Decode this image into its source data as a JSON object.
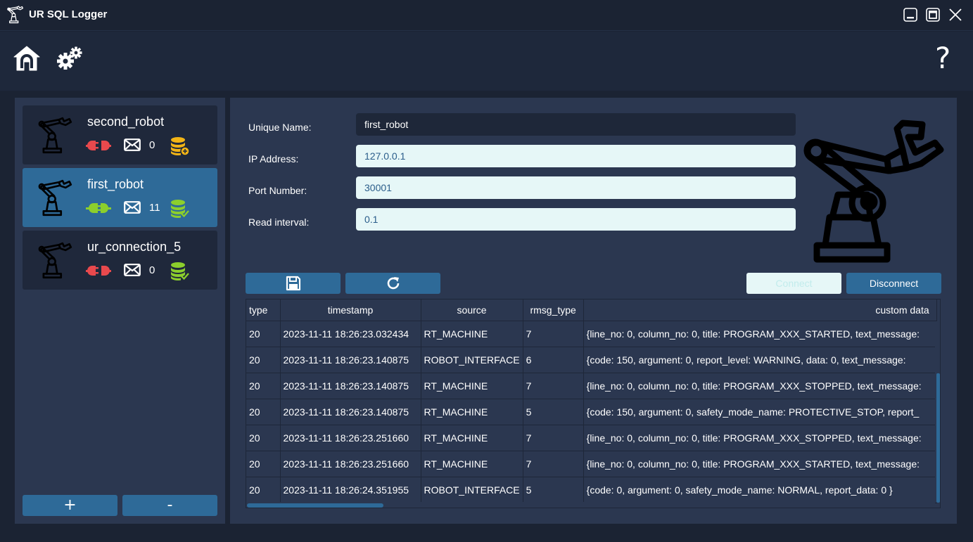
{
  "app": {
    "title": "UR SQL Logger"
  },
  "toolbar": {
    "help_label": "?"
  },
  "connections": [
    {
      "name": "second_robot",
      "status": "disconnected",
      "message_count": "0",
      "db_state": "pending"
    },
    {
      "name": "first_robot",
      "status": "connected",
      "message_count": "11",
      "db_state": "ok"
    },
    {
      "name": "ur_connection_5",
      "status": "disconnected",
      "message_count": "0",
      "db_state": "ok"
    }
  ],
  "sidebar": {
    "add_label": "+",
    "remove_label": "-"
  },
  "form": {
    "unique_name": {
      "label": "Unique Name:",
      "value": "first_robot"
    },
    "ip_address": {
      "label": "IP Address:",
      "value": "127.0.0.1"
    },
    "port_number": {
      "label": "Port Number:",
      "value": "30001"
    },
    "read_interval": {
      "label": "Read interval:",
      "value": "0.1"
    }
  },
  "buttons": {
    "connect_label": "Connect",
    "disconnect_label": "Disconnect"
  },
  "table": {
    "columns": [
      "type",
      "timestamp",
      "source",
      "rmsg_type",
      "custom data"
    ],
    "rows": [
      [
        "20",
        "2023-11-11 18:26:23.032434",
        "RT_MACHINE",
        "7",
        "{line_no: 0, column_no: 0, title: PROGRAM_XXX_STARTED, text_message: "
      ],
      [
        "20",
        "2023-11-11 18:26:23.140875",
        "ROBOT_INTERFACE",
        "6",
        "{code: 150, argument: 0, report_level: WARNING, data: 0, text_message: "
      ],
      [
        "20",
        "2023-11-11 18:26:23.140875",
        "RT_MACHINE",
        "7",
        "{line_no: 0, column_no: 0, title: PROGRAM_XXX_STOPPED, text_message: "
      ],
      [
        "20",
        "2023-11-11 18:26:23.140875",
        "RT_MACHINE",
        "5",
        "{code: 150, argument: 0, safety_mode_name: PROTECTIVE_STOP, report_"
      ],
      [
        "20",
        "2023-11-11 18:26:23.251660",
        "RT_MACHINE",
        "7",
        "{line_no: 0, column_no: 0, title: PROGRAM_XXX_STOPPED, text_message: "
      ],
      [
        "20",
        "2023-11-11 18:26:23.251660",
        "RT_MACHINE",
        "7",
        "{line_no: 0, column_no: 0, title: PROGRAM_XXX_STARTED, text_message: "
      ],
      [
        "20",
        "2023-11-11 18:26:24.351955",
        "ROBOT_INTERFACE",
        "5",
        "{code: 0, argument: 0, safety_mode_name: NORMAL, report_data: 0 }"
      ]
    ]
  },
  "colors": {
    "accent": "#2e6a98",
    "disconnected": "#e8494d",
    "connected": "#8ccf2c",
    "db_pending": "#f2b416",
    "db_ok": "#8ccf2c"
  },
  "icons": [
    "robot-arm-icon",
    "minimize-icon",
    "maximize-icon",
    "close-icon",
    "home-icon",
    "gears-icon",
    "help-icon",
    "plug-icon",
    "envelope-icon",
    "database-icon",
    "save-icon",
    "refresh-icon"
  ]
}
